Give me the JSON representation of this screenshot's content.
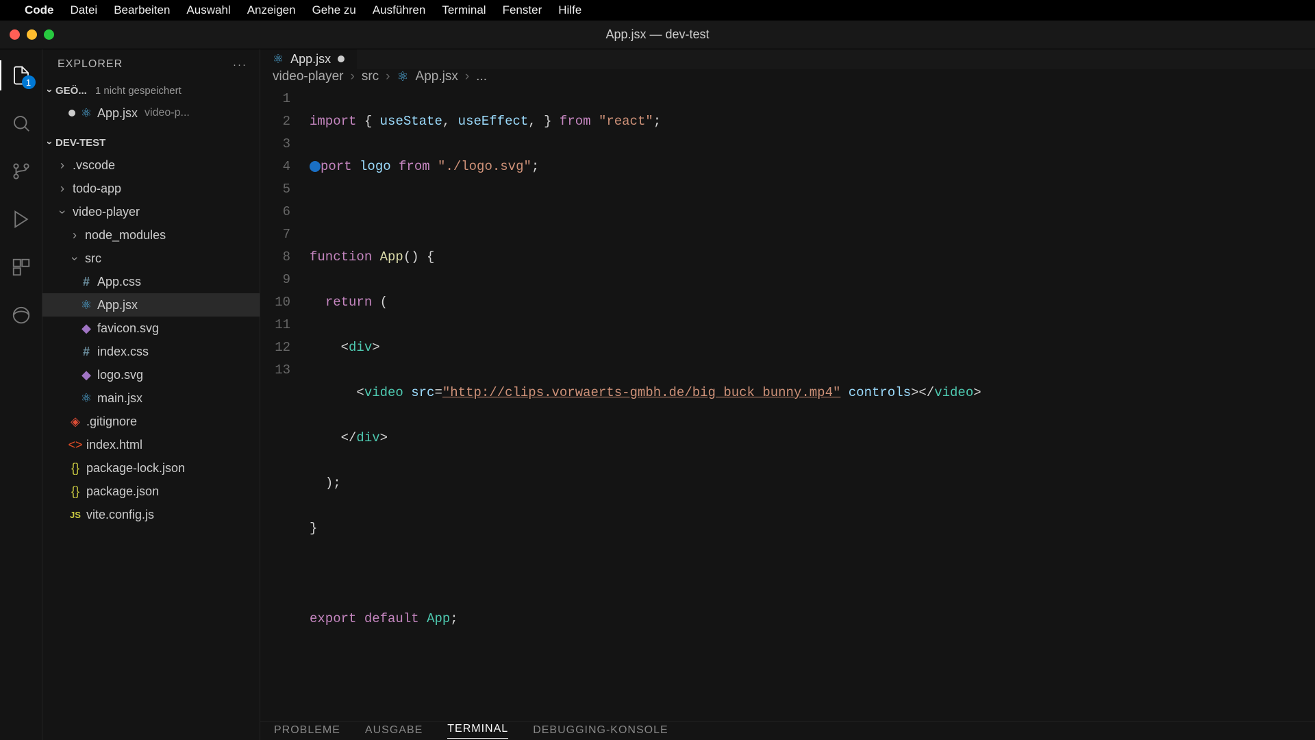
{
  "menubar": {
    "app": "Code",
    "items": [
      "Datei",
      "Bearbeiten",
      "Auswahl",
      "Anzeigen",
      "Gehe zu",
      "Ausführen",
      "Terminal",
      "Fenster",
      "Hilfe"
    ]
  },
  "window": {
    "title": "App.jsx — dev-test"
  },
  "activitybar": {
    "badge": "1"
  },
  "sidebar": {
    "title": "EXPLORER",
    "open_editors": {
      "label": "GEÖ...",
      "unsaved": "1 nicht gespeichert",
      "items": [
        {
          "name": "App.jsx",
          "detail": "video-p..."
        }
      ]
    },
    "workspace": {
      "label": "DEV-TEST",
      "tree": [
        {
          "name": ".vscode",
          "type": "folder",
          "open": false,
          "depth": 1
        },
        {
          "name": "todo-app",
          "type": "folder",
          "open": false,
          "depth": 1
        },
        {
          "name": "video-player",
          "type": "folder",
          "open": true,
          "depth": 1
        },
        {
          "name": "node_modules",
          "type": "folder",
          "open": false,
          "depth": 2
        },
        {
          "name": "src",
          "type": "folder",
          "open": true,
          "depth": 2
        },
        {
          "name": "App.css",
          "type": "file",
          "icon": "css",
          "depth": 3
        },
        {
          "name": "App.jsx",
          "type": "file",
          "icon": "react",
          "depth": 3,
          "selected": true
        },
        {
          "name": "favicon.svg",
          "type": "file",
          "icon": "svg",
          "depth": 3
        },
        {
          "name": "index.css",
          "type": "file",
          "icon": "css",
          "depth": 3
        },
        {
          "name": "logo.svg",
          "type": "file",
          "icon": "svg",
          "depth": 3
        },
        {
          "name": "main.jsx",
          "type": "file",
          "icon": "react",
          "depth": 3
        },
        {
          "name": ".gitignore",
          "type": "file",
          "icon": "git",
          "depth": 2
        },
        {
          "name": "index.html",
          "type": "file",
          "icon": "html",
          "depth": 2
        },
        {
          "name": "package-lock.json",
          "type": "file",
          "icon": "json",
          "depth": 2
        },
        {
          "name": "package.json",
          "type": "file",
          "icon": "json",
          "depth": 2
        },
        {
          "name": "vite.config.js",
          "type": "file",
          "icon": "js",
          "depth": 2
        }
      ]
    }
  },
  "tabs": [
    {
      "label": "App.jsx",
      "dirty": true
    }
  ],
  "breadcrumbs": [
    "video-player",
    "src",
    "App.jsx",
    "..."
  ],
  "code": {
    "lines": [
      {
        "n": 1
      },
      {
        "n": 2
      },
      {
        "n": 3
      },
      {
        "n": 4
      },
      {
        "n": 5
      },
      {
        "n": 6
      },
      {
        "n": 7
      },
      {
        "n": 8
      },
      {
        "n": 9
      },
      {
        "n": 10
      },
      {
        "n": 11
      },
      {
        "n": 12
      },
      {
        "n": 13
      }
    ],
    "tokens": {
      "l1_import": "import",
      "l1_useState": "useState",
      "l1_useEffect": "useEffect",
      "l1_from": "from",
      "l1_react": "\"react\"",
      "l2_import": "port",
      "l2_logo": "logo",
      "l2_from": "from",
      "l2_path": "\"./logo.svg\"",
      "l4_function": "function",
      "l4_app": "App",
      "l5_return": "return",
      "l6_div": "div",
      "l7_video": "video",
      "l7_src": "src",
      "l7_url": "\"http://clips.vorwaerts-gmbh.de/big_buck_bunny.mp4\"",
      "l7_controls": "controls",
      "l8_div": "div",
      "l12_export": "export",
      "l12_default": "default",
      "l12_app": "App"
    }
  },
  "panel": {
    "tabs": [
      "PROBLEME",
      "AUSGABE",
      "TERMINAL",
      "DEBUGGING-KONSOLE"
    ],
    "active": "TERMINAL"
  }
}
